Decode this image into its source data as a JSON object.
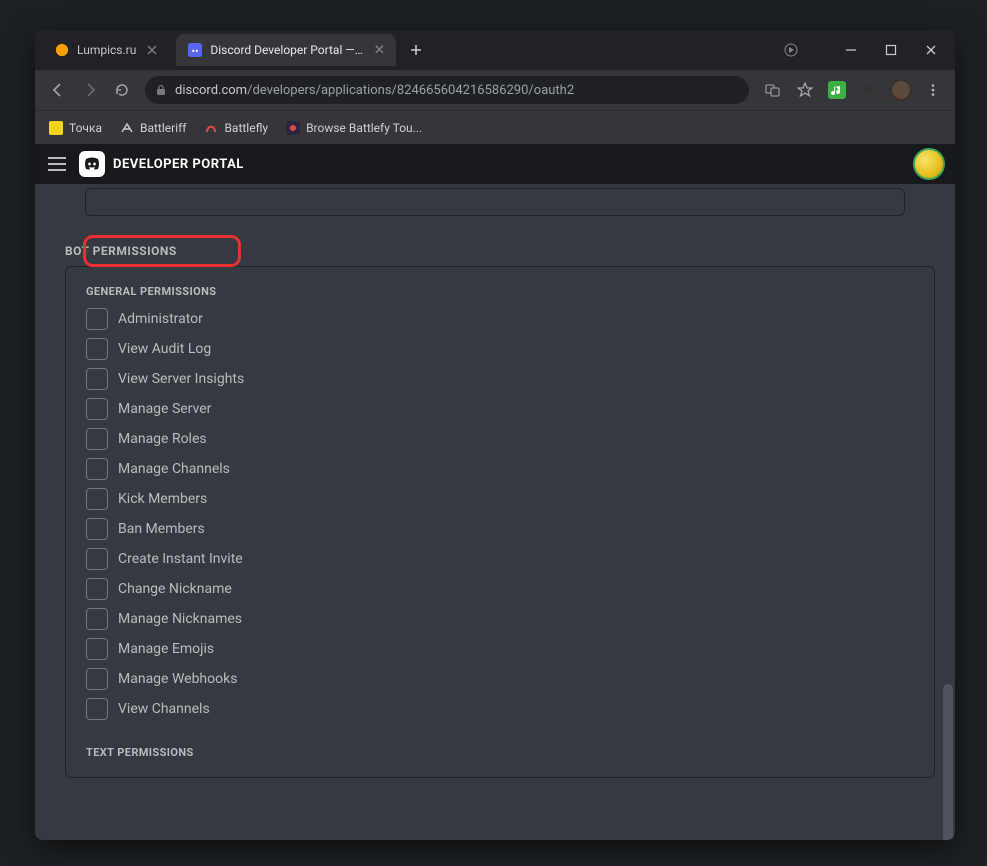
{
  "window": {
    "minimize": "–",
    "maximize": "□",
    "close": "×"
  },
  "tabs": [
    {
      "title": "Lumpics.ru",
      "active": false
    },
    {
      "title": "Discord Developer Portal — My A",
      "active": true
    }
  ],
  "addressbar": {
    "host": "discord.com",
    "path": "/developers/applications/824665604216586290/oauth2"
  },
  "bookmarks": [
    {
      "label": "Точка"
    },
    {
      "label": "Battleriff"
    },
    {
      "label": "Battlefly"
    },
    {
      "label": "Browse Battlefy Tou..."
    }
  ],
  "discord": {
    "header_title": "DEVELOPER PORTAL",
    "section_title": "BOT PERMISSIONS",
    "groups": [
      {
        "title": "GENERAL PERMISSIONS",
        "perms": [
          "Administrator",
          "View Audit Log",
          "View Server Insights",
          "Manage Server",
          "Manage Roles",
          "Manage Channels",
          "Kick Members",
          "Ban Members",
          "Create Instant Invite",
          "Change Nickname",
          "Manage Nicknames",
          "Manage Emojis",
          "Manage Webhooks",
          "View Channels"
        ]
      },
      {
        "title": "TEXT PERMISSIONS",
        "perms": []
      }
    ]
  }
}
